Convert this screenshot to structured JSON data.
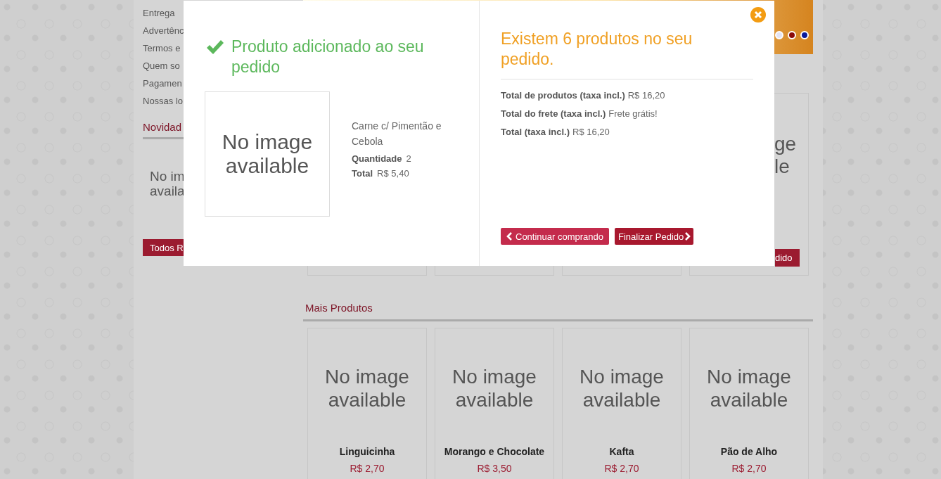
{
  "sidebar": {
    "links": [
      "Entrega",
      "Advertênc",
      "Termos e",
      "Quem so",
      "Pagamen",
      "Nossas lo"
    ],
    "news_title": "Novidad",
    "no_image": [
      "No im",
      "availa"
    ],
    "all_button": "Todos R"
  },
  "banner": {
    "dots": [
      {
        "color": "#e4e4f4"
      },
      {
        "color": "#8b0a0a"
      },
      {
        "color": "#0a1a9b"
      }
    ]
  },
  "featured": {
    "tail_image_text": [
      "ge",
      "le"
    ],
    "tail_button": "dido"
  },
  "more_products": {
    "title": "Mais Produtos",
    "products": [
      {
        "image_text": "No image available",
        "name": "Linguicinha",
        "price": "R$ 2,70"
      },
      {
        "image_text": "No image available",
        "name": "Morango e Chocolate",
        "price": "R$ 3,50"
      },
      {
        "image_text": "No image available",
        "name": "Kafta",
        "price": "R$ 2,70"
      },
      {
        "image_text": "No image available",
        "name": "Pão de Alho",
        "price": "R$ 2,70"
      }
    ]
  },
  "modal": {
    "left": {
      "title": "Produto adicionado ao seu pedido",
      "image_text": "No image available",
      "product_name": "Carne c/ Pimentão e Cebola",
      "quantity_label": "Quantidade",
      "quantity": "2",
      "total_label": "Total",
      "total": "R$ 5,40"
    },
    "right": {
      "title": "Existem 6 produtos no seu pedido.",
      "lines": [
        {
          "label": "Total de produtos (taxa incl.)",
          "value": "R$ 16,20"
        },
        {
          "label": "Total do frete (taxa incl.)",
          "value": "Frete grátis!"
        },
        {
          "label": "Total (taxa incl.)",
          "value": "R$ 16,20"
        }
      ],
      "buttons": [
        {
          "kind": "back",
          "label": "Continuar comprando"
        },
        {
          "kind": "next",
          "label": "Finalizar Pedido"
        }
      ]
    }
  }
}
